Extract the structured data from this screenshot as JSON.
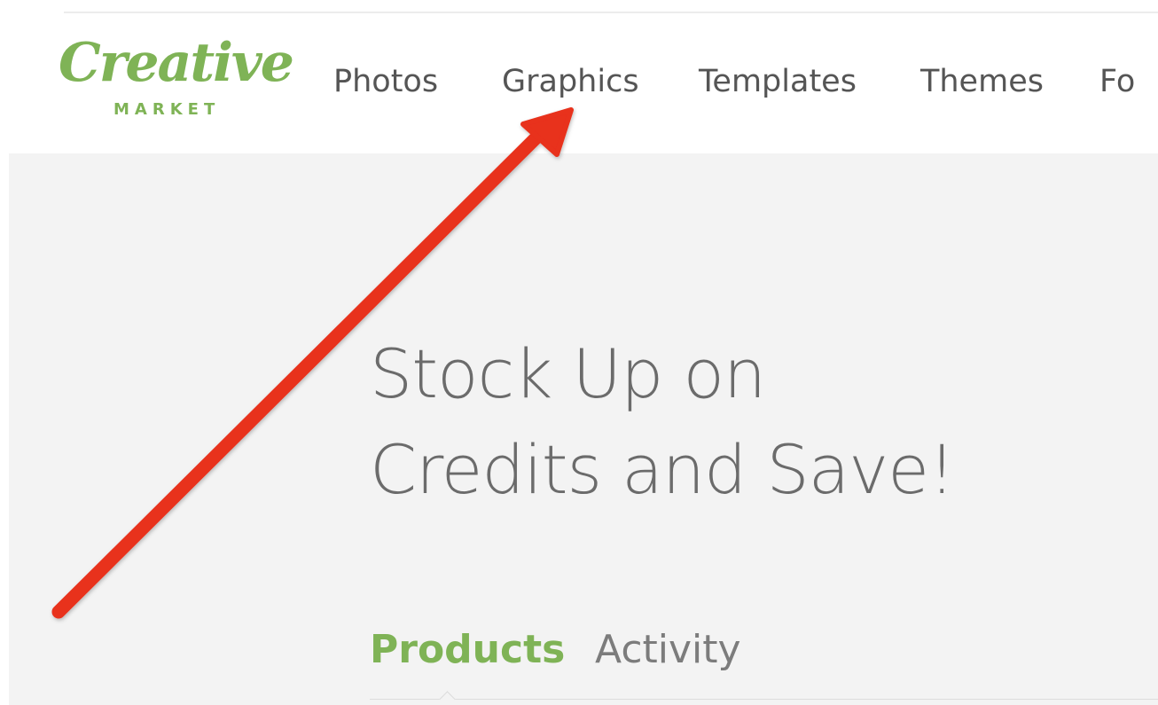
{
  "logo": {
    "script_text": "Creative",
    "sub_text": "MARKET",
    "color": "#7fb356"
  },
  "nav": {
    "items": [
      {
        "label": "Photos"
      },
      {
        "label": "Graphics"
      },
      {
        "label": "Templates"
      },
      {
        "label": "Themes"
      },
      {
        "label": "Fo"
      }
    ]
  },
  "hero": {
    "title_line1": "Stock Up on",
    "title_line2": "Credits and Save!",
    "background": "#f3f3f3"
  },
  "tabs": {
    "items": [
      {
        "label": "Products",
        "active": true
      },
      {
        "label": "Activity",
        "active": false
      }
    ],
    "active_color": "#7fb356"
  },
  "annotation": {
    "type": "arrow",
    "color": "#e8301c",
    "points_to": "Graphics"
  }
}
